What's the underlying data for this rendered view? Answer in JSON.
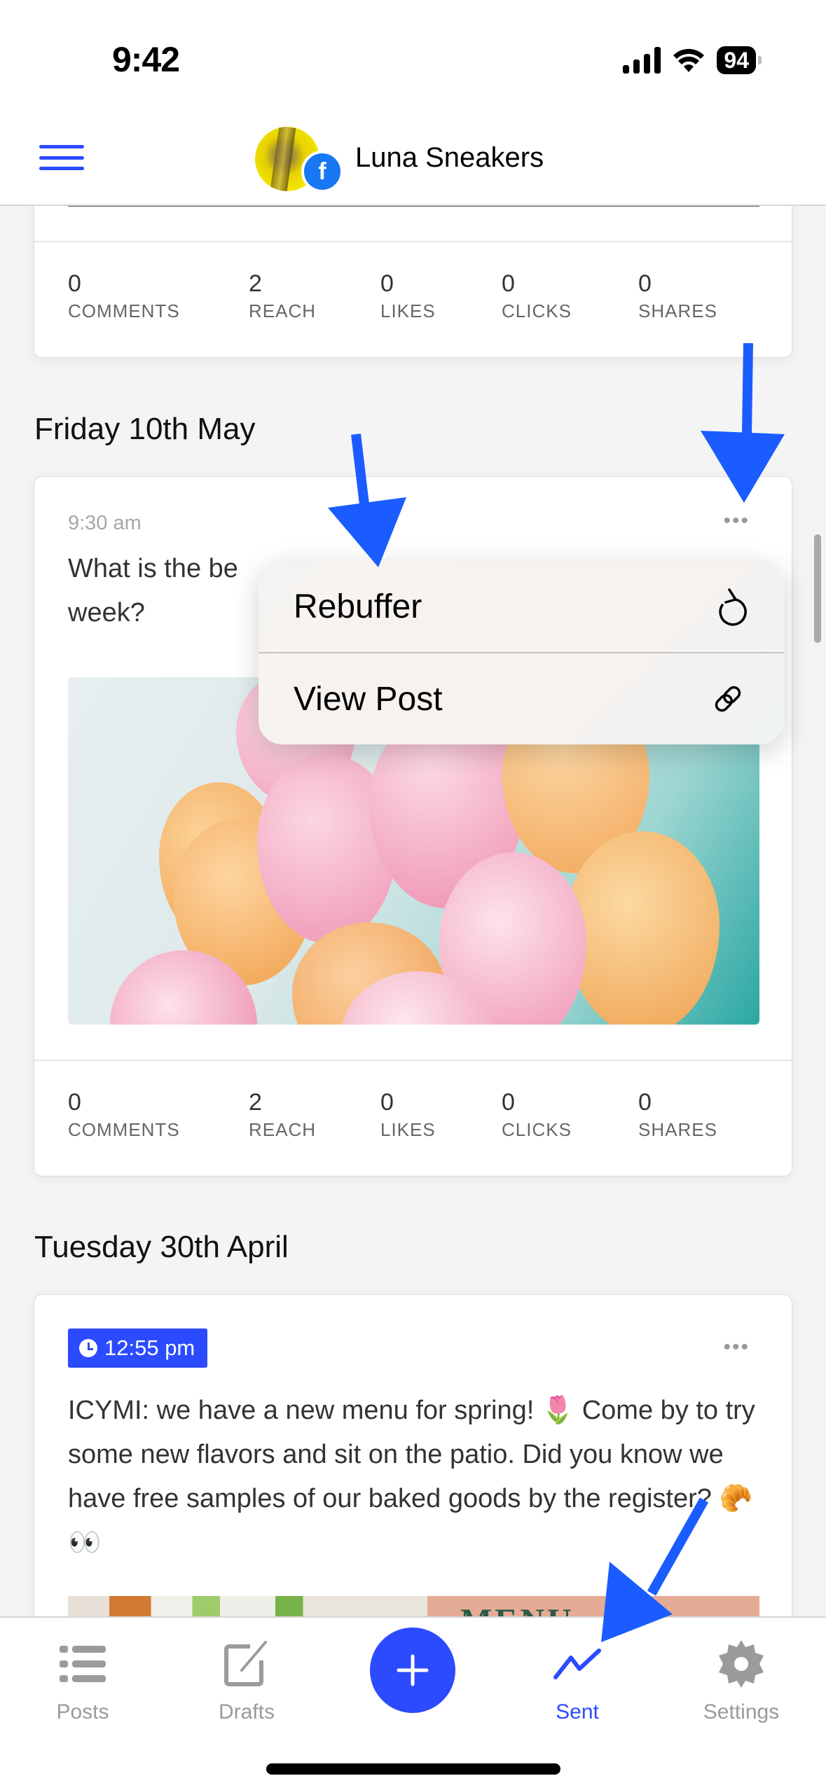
{
  "status_bar": {
    "time": "9:42",
    "battery": "94"
  },
  "header": {
    "account_name": "Luna Sneakers",
    "network": "facebook",
    "menu_icon": "hamburger-icon"
  },
  "stat_labels": [
    "COMMENTS",
    "REACH",
    "LIKES",
    "CLICKS",
    "SHARES"
  ],
  "posts": [
    {
      "stats": [
        {
          "value": "0"
        },
        {
          "value": "2"
        },
        {
          "value": "0"
        },
        {
          "value": "0"
        },
        {
          "value": "0"
        }
      ]
    },
    {
      "day": "Friday 10th May",
      "time": "9:30 am",
      "text_line1": "What is the be",
      "text_line2": "week?",
      "image": "balloons-photo",
      "more": "•••",
      "stats": [
        {
          "value": "0"
        },
        {
          "value": "2"
        },
        {
          "value": "0"
        },
        {
          "value": "0"
        },
        {
          "value": "0"
        }
      ]
    },
    {
      "day": "Tuesday 30th April",
      "time": "12:55 pm",
      "text": "ICYMI: we have a new menu for spring! 🌷 Come by to try some new flavors and sit on the patio. Did you know we have free samples of our baked goods by the register? 🥐👀",
      "more": "•••",
      "image": "menu-photo"
    }
  ],
  "context_menu": {
    "items": [
      {
        "label": "Rebuffer",
        "icon": "refresh-icon"
      },
      {
        "label": "View Post",
        "icon": "link-icon"
      }
    ]
  },
  "tabbar": {
    "tabs": [
      {
        "label": "Posts",
        "icon": "list-icon"
      },
      {
        "label": "Drafts",
        "icon": "compose-icon"
      },
      {
        "label": "",
        "icon": "plus-icon"
      },
      {
        "label": "Sent",
        "icon": "chart-line-icon",
        "active": true
      },
      {
        "label": "Settings",
        "icon": "gear-icon"
      }
    ]
  },
  "colors": {
    "accent": "#2c4bff",
    "facebook": "#1877f2",
    "annotation_arrow": "#1a5cff"
  }
}
